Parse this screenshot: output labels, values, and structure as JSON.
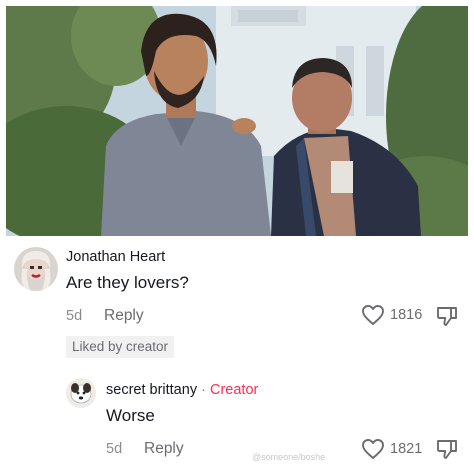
{
  "comments": [
    {
      "username": "Jonathan Heart",
      "text": "Are they lovers?",
      "age": "5d",
      "reply_label": "Reply",
      "likes": "1816",
      "liked_by_creator": "Liked by creator"
    }
  ],
  "replies": [
    {
      "username": "secret brittany",
      "separator": "·",
      "badge": "Creator",
      "text": "Worse",
      "age": "5d",
      "reply_label": "Reply",
      "likes": "1821"
    }
  ],
  "watermark": "@someone/boshe",
  "colors": {
    "creator_badge": "#fe2c55",
    "secondary_text": "#8a8b91",
    "primary_text": "#161823"
  },
  "icons": {
    "like": "heart-outline-icon",
    "dislike": "thumbs-down-outline-icon"
  }
}
